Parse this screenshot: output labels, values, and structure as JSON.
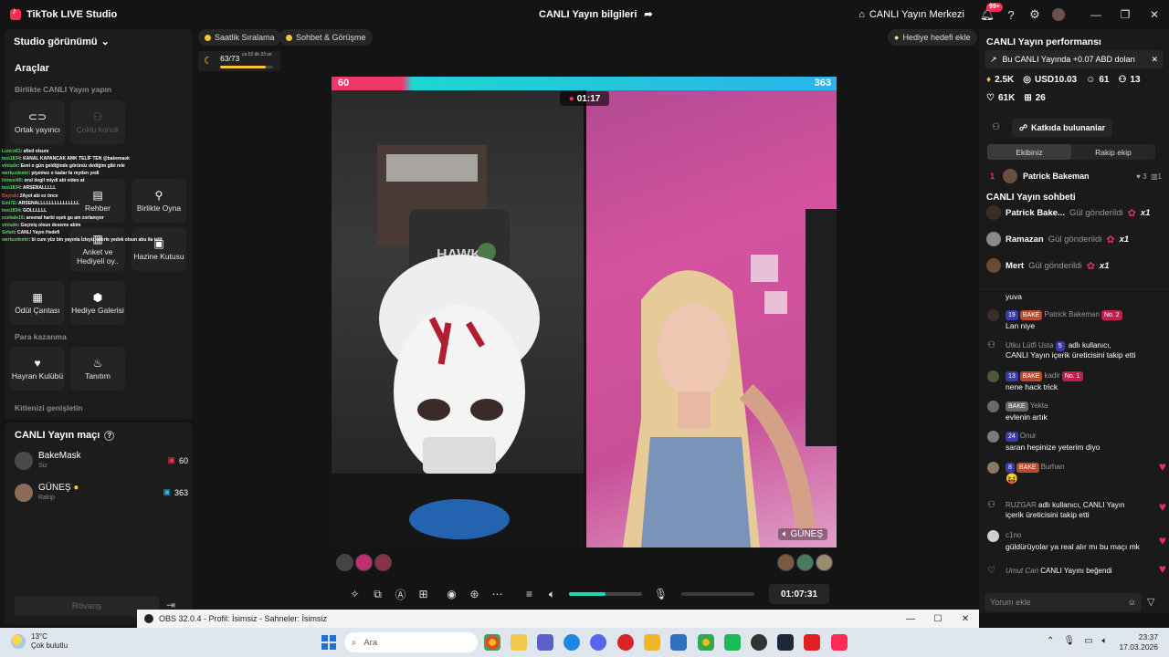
{
  "app": {
    "name": "TikTok LIVE Studio",
    "title": "CANLI Yayın bilgileri",
    "center_btn": "CANLI Yayın Merkezi",
    "notif_count": "99+"
  },
  "left": {
    "studio_view": "Studio görünümü",
    "tools_title": "Araçlar",
    "sec_together": "Birlikte CANLI Yayın yapın",
    "tools": [
      "Ortak yayıncı",
      "Çoklu konuk",
      "Rehber",
      "Birlikte Oyna",
      "Anket ve Hediyeli oy..",
      "Hazine Kutusu",
      "Ödül Çantası",
      "Hediye Galerisi"
    ],
    "sec_earn": "Para kazanma",
    "earn": [
      "Hayran Kulübü",
      "Tanıtım"
    ],
    "sec_expand": "Kitlenizi genişletin"
  },
  "overlay_chat": [
    {
      "n": "Lunco61",
      "t": ": afied olsunı"
    },
    {
      "n": "bso1834",
      "t": ": KANAL KAPANCAK AMK TELİF TEN @bakemask"
    },
    {
      "n": "viniude",
      "t": ": Evet o gün geldiğinde görünüz dediğim gibi rele"
    },
    {
      "n": "wertuzdemir",
      "t": ": piyemez o kadar fa reyden yedi"
    },
    {
      "n": "linnesi40",
      "t": ": orul degil miydi abi video at"
    },
    {
      "n": "bso1834",
      "t": ": ARSENALLLLL"
    },
    {
      "n": "Bayrak",
      "t": ": 2Ayol abi ez önce"
    },
    {
      "n": "Emi7E",
      "t": ": ARSENALLLLLLLLLLLLLLL"
    },
    {
      "n": "bso1834",
      "t": ": GOLLLLLL"
    },
    {
      "n": "ecekale16",
      "t": ": arsenal harbi eşek gu am zorlanıyor"
    },
    {
      "n": "viniude",
      "t": ": Geçmiş olsun deseme abim"
    },
    {
      "n": "Sefatt",
      "t": ": CANLI Yayın Hedefi"
    },
    {
      "n": "wertuzdemir",
      "t": ": bi cum yüz bin yayınla İzleyiz ederle yedek olsun abu ila telit"
    }
  ],
  "match": {
    "title": "CANLI Yayın maçı",
    "p1": {
      "name": "BakeMask",
      "sub": "Siz",
      "score": "60"
    },
    "p2": {
      "name": "GÜNEŞ",
      "sub": "Rakip",
      "score": "363"
    },
    "rematch": "Rövanş"
  },
  "center": {
    "pill1": "Saatlik Sıralama",
    "pill2": "Sohbet & Görüşme",
    "gift_goal": "Hediye hedefi ekle",
    "goal_value": "63/73",
    "goal_time": "ca 52 dk 33 sn",
    "goal_progress": 0.86,
    "score_left": "60",
    "score_right": "363",
    "score_left_share": 0.14,
    "battle_timer": "01:17",
    "cam_left_text": "HAWK",
    "opponent_tag": "GÜNEŞ",
    "volume_level": 0.5,
    "elapsed": "01:07:31"
  },
  "right": {
    "perf_title": "CANLI Yayın performansı",
    "notice": "Bu CANLI Yayında +0.07 ABD doları",
    "stats": [
      {
        "icon": "♦",
        "v": "2.5K"
      },
      {
        "icon": "◎",
        "v": "USD10.03"
      },
      {
        "icon": "☺",
        "v": "61"
      },
      {
        "icon": "⚇",
        "v": "13"
      },
      {
        "icon": "♡",
        "v": "61K"
      },
      {
        "icon": "⊞",
        "v": "26"
      }
    ],
    "contributors": "Katkıda bulunanlar",
    "team_tabs": [
      "Ekibiniz",
      "Rakip ekip"
    ],
    "rank": {
      "pos": "1",
      "name": "Patrick Bakeman",
      "likes": "3",
      "count": "1"
    },
    "chat_title": "CANLI Yayın sohbeti",
    "gifts": [
      {
        "name": "Patrick Bake...",
        "text": "Gül gönderildi",
        "mult": "x1"
      },
      {
        "name": "Ramazan",
        "text": "Gül gönderildi",
        "mult": "x1"
      },
      {
        "name": "Mert",
        "text": "Gül gönderildi",
        "mult": "x1"
      }
    ],
    "messages": {
      "m0": "yuva",
      "m1_lvl": "19",
      "m1_tag": "BAKE",
      "m1_user": "Patrick Bakeman",
      "m1_no": "No. 2",
      "m1_text": "Lan niye",
      "m2_user": "Utku Lütfi Usta",
      "m2_lvl": "5",
      "m2_text1": "adlı kullanıcı,",
      "m2_text2": "CANLI Yayın içerik üreticisini takip etti",
      "m3_lvl": "13",
      "m3_tag": "BAKE",
      "m3_user": "kadir",
      "m3_no": "No. 1",
      "m3_text": "nene hack trick",
      "m4_tag": "BAKE",
      "m4_user": "Yekta",
      "m4_text": "evlenin artık",
      "m5_lvl": "24",
      "m5_user": "Onur",
      "m5_text": "saran hepinize yeterim diyo",
      "m6_lvl": "8",
      "m6_tag": "BAKE",
      "m6_user": "Burhan",
      "m6_text": "😝",
      "m7_user": "RUZGAR",
      "m7_text1": "adlı kullanıcı, CANLI Yayın",
      "m7_text2": "içerik üreticisini takip etti",
      "m8_user": "c1no",
      "m8_text": "güldürüyolar ya real alır mı bu maçı mk",
      "m9_user": "Umut Can",
      "m9_text": "CANLI Yayını beğendi"
    },
    "comment_placeholder": "Yorum ekle"
  },
  "obs": {
    "title": "OBS 32.0.4 - Profil: İsimsiz - Sahneler: İsimsiz"
  },
  "taskbar": {
    "temp": "13°C",
    "weather": "Çok bulutlu",
    "search": "Ara",
    "time": "23:37",
    "date": "17.03.2026"
  },
  "colors": {
    "accent": "#fe2c55",
    "teal": "#1fd6b8",
    "panel": "#1c1c1c"
  }
}
